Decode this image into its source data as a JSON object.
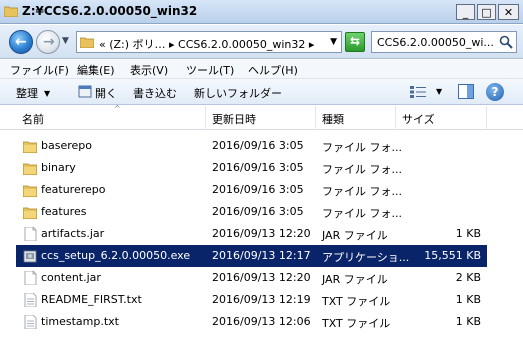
{
  "window": {
    "title": "Z:¥CCS6.2.0.00050_win32"
  },
  "address": {
    "path": "«  (Z:) ボリ… ▸ CCS6.2.0.00050_win32 ▸",
    "search_placeholder": "CCS6.2.0.00050_wi..."
  },
  "menu": [
    "ファイル(F)",
    "編集(E)",
    "表示(V)",
    "ツール(T)",
    "ヘルプ(H)"
  ],
  "commands": {
    "organize": "整理",
    "open": "開く",
    "burn": "書き込む",
    "new_folder": "新しいフォルダー"
  },
  "columns": {
    "name": "名前",
    "date": "更新日時",
    "type": "種類",
    "size": "サイズ"
  },
  "files": [
    {
      "name": "baserepo",
      "date": "2016/09/16 3:05",
      "type": "ファイル フォ...",
      "size": "",
      "icon": "folder-icon"
    },
    {
      "name": "binary",
      "date": "2016/09/16 3:05",
      "type": "ファイル フォ...",
      "size": "",
      "icon": "folder-icon"
    },
    {
      "name": "featurerepo",
      "date": "2016/09/16 3:05",
      "type": "ファイル フォ...",
      "size": "",
      "icon": "folder-icon"
    },
    {
      "name": "features",
      "date": "2016/09/16 3:05",
      "type": "ファイル フォ...",
      "size": "",
      "icon": "folder-icon"
    },
    {
      "name": "artifacts.jar",
      "date": "2016/09/13 12:20",
      "type": "JAR ファイル",
      "size": "1 KB",
      "icon": "jar-file-icon"
    },
    {
      "name": "ccs_setup_6.2.0.00050.exe",
      "date": "2016/09/13 12:17",
      "type": "アプリケーショ...",
      "size": "15,551 KB",
      "icon": "exe-file-icon",
      "selected": true
    },
    {
      "name": "content.jar",
      "date": "2016/09/13 12:20",
      "type": "JAR ファイル",
      "size": "2 KB",
      "icon": "jar-file-icon"
    },
    {
      "name": "README_FIRST.txt",
      "date": "2016/09/13 12:19",
      "type": "TXT ファイル",
      "size": "1 KB",
      "icon": "text-file-icon"
    },
    {
      "name": "timestamp.txt",
      "date": "2016/09/13 12:06",
      "type": "TXT ファイル",
      "size": "1 KB",
      "icon": "text-file-icon"
    }
  ]
}
